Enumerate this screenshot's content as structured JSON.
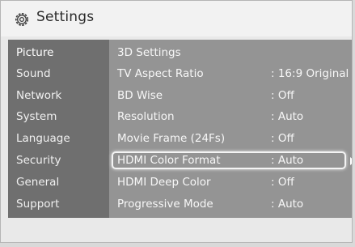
{
  "header": {
    "title": "Settings",
    "icon": "gear-icon"
  },
  "sidebar": {
    "items": [
      {
        "label": "Picture"
      },
      {
        "label": "Sound"
      },
      {
        "label": "Network"
      },
      {
        "label": "System"
      },
      {
        "label": "Language"
      },
      {
        "label": "Security"
      },
      {
        "label": "General"
      },
      {
        "label": "Support"
      }
    ],
    "active_index": 0
  },
  "menu": {
    "rows": [
      {
        "label": "3D Settings",
        "value": ""
      },
      {
        "label": "TV Aspect Ratio",
        "value": ": 16:9 Original"
      },
      {
        "label": "BD Wise",
        "value": ": Off"
      },
      {
        "label": "Resolution",
        "value": ": Auto"
      },
      {
        "label": "Movie Frame (24Fs)",
        "value": ": Off"
      },
      {
        "label": "HDMI Color Format",
        "value": ": Auto"
      },
      {
        "label": "HDMI Deep Color",
        "value": ": Off"
      },
      {
        "label": "Progressive Mode",
        "value": ": Auto"
      }
    ],
    "focused_index": 5
  },
  "colors": {
    "sidebar_bg": "#6f6f6f",
    "content_bg": "#949494",
    "panel_bg": "#e9e9e9",
    "focus_border": "#f4f4f4"
  }
}
